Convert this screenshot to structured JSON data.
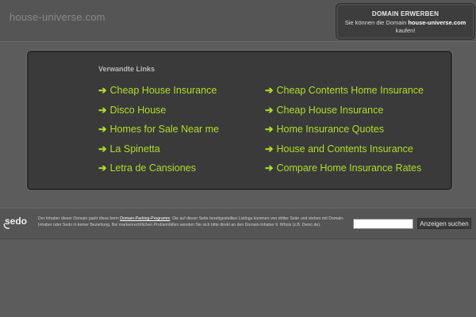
{
  "header": {
    "site_title": "house-universe.com",
    "buy_box": {
      "title": "DOMAIN ERWERBEN",
      "text_before": "Sie können die Domain ",
      "domain": "house-universe.com",
      "text_after": "kaufen!"
    }
  },
  "panel": {
    "title": "Verwandte Links",
    "arrow": "➔",
    "links_left": [
      "Cheap House Insurance",
      "Disco House",
      "Homes for Sale Near me",
      "La Spinetta",
      "Letra de Cansiones"
    ],
    "links_right": [
      "Cheap Contents Home Insurance",
      "Cheap House Insurance",
      "Home Insurance Quotes",
      "House and Contents Insurance",
      "Compare Home Insurance Rates"
    ]
  },
  "footer": {
    "logo": "sedo",
    "text_part1": "Der Inhaber dieser Domain parkt diese beim ",
    "program_link": "Domain-Parking-Programm",
    "text_part2": ". Die auf dieser Seite bereitgestellten Listings kommen von dritter Seite und stehen mit Domain-Inhaber oder Sedo in keiner Beziehung. Bei markenrechtlichen Problemfällen wenden Sie sich bitte direkt an den Domain-Inhaber lt. Whois (z.B. Denic.de).",
    "search_value": "",
    "search_button": "Anzeigen suchen"
  },
  "colors": {
    "background": "#5c5c5c",
    "panel": "#3a3a3a",
    "link": "#aede26"
  }
}
